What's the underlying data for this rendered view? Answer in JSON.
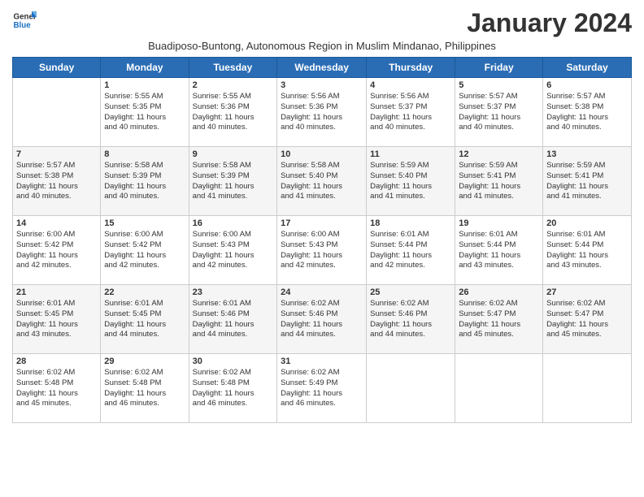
{
  "logo": {
    "general": "General",
    "blue": "Blue"
  },
  "title": "January 2024",
  "subtitle": "Buadiposo-Buntong, Autonomous Region in Muslim Mindanao, Philippines",
  "days_of_week": [
    "Sunday",
    "Monday",
    "Tuesday",
    "Wednesday",
    "Thursday",
    "Friday",
    "Saturday"
  ],
  "weeks": [
    [
      {
        "day": "",
        "info": ""
      },
      {
        "day": "1",
        "info": "Sunrise: 5:55 AM\nSunset: 5:35 PM\nDaylight: 11 hours\nand 40 minutes."
      },
      {
        "day": "2",
        "info": "Sunrise: 5:55 AM\nSunset: 5:36 PM\nDaylight: 11 hours\nand 40 minutes."
      },
      {
        "day": "3",
        "info": "Sunrise: 5:56 AM\nSunset: 5:36 PM\nDaylight: 11 hours\nand 40 minutes."
      },
      {
        "day": "4",
        "info": "Sunrise: 5:56 AM\nSunset: 5:37 PM\nDaylight: 11 hours\nand 40 minutes."
      },
      {
        "day": "5",
        "info": "Sunrise: 5:57 AM\nSunset: 5:37 PM\nDaylight: 11 hours\nand 40 minutes."
      },
      {
        "day": "6",
        "info": "Sunrise: 5:57 AM\nSunset: 5:38 PM\nDaylight: 11 hours\nand 40 minutes."
      }
    ],
    [
      {
        "day": "7",
        "info": "Sunrise: 5:57 AM\nSunset: 5:38 PM\nDaylight: 11 hours\nand 40 minutes."
      },
      {
        "day": "8",
        "info": "Sunrise: 5:58 AM\nSunset: 5:39 PM\nDaylight: 11 hours\nand 40 minutes."
      },
      {
        "day": "9",
        "info": "Sunrise: 5:58 AM\nSunset: 5:39 PM\nDaylight: 11 hours\nand 41 minutes."
      },
      {
        "day": "10",
        "info": "Sunrise: 5:58 AM\nSunset: 5:40 PM\nDaylight: 11 hours\nand 41 minutes."
      },
      {
        "day": "11",
        "info": "Sunrise: 5:59 AM\nSunset: 5:40 PM\nDaylight: 11 hours\nand 41 minutes."
      },
      {
        "day": "12",
        "info": "Sunrise: 5:59 AM\nSunset: 5:41 PM\nDaylight: 11 hours\nand 41 minutes."
      },
      {
        "day": "13",
        "info": "Sunrise: 5:59 AM\nSunset: 5:41 PM\nDaylight: 11 hours\nand 41 minutes."
      }
    ],
    [
      {
        "day": "14",
        "info": "Sunrise: 6:00 AM\nSunset: 5:42 PM\nDaylight: 11 hours\nand 42 minutes."
      },
      {
        "day": "15",
        "info": "Sunrise: 6:00 AM\nSunset: 5:42 PM\nDaylight: 11 hours\nand 42 minutes."
      },
      {
        "day": "16",
        "info": "Sunrise: 6:00 AM\nSunset: 5:43 PM\nDaylight: 11 hours\nand 42 minutes."
      },
      {
        "day": "17",
        "info": "Sunrise: 6:00 AM\nSunset: 5:43 PM\nDaylight: 11 hours\nand 42 minutes."
      },
      {
        "day": "18",
        "info": "Sunrise: 6:01 AM\nSunset: 5:44 PM\nDaylight: 11 hours\nand 42 minutes."
      },
      {
        "day": "19",
        "info": "Sunrise: 6:01 AM\nSunset: 5:44 PM\nDaylight: 11 hours\nand 43 minutes."
      },
      {
        "day": "20",
        "info": "Sunrise: 6:01 AM\nSunset: 5:44 PM\nDaylight: 11 hours\nand 43 minutes."
      }
    ],
    [
      {
        "day": "21",
        "info": "Sunrise: 6:01 AM\nSunset: 5:45 PM\nDaylight: 11 hours\nand 43 minutes."
      },
      {
        "day": "22",
        "info": "Sunrise: 6:01 AM\nSunset: 5:45 PM\nDaylight: 11 hours\nand 44 minutes."
      },
      {
        "day": "23",
        "info": "Sunrise: 6:01 AM\nSunset: 5:46 PM\nDaylight: 11 hours\nand 44 minutes."
      },
      {
        "day": "24",
        "info": "Sunrise: 6:02 AM\nSunset: 5:46 PM\nDaylight: 11 hours\nand 44 minutes."
      },
      {
        "day": "25",
        "info": "Sunrise: 6:02 AM\nSunset: 5:46 PM\nDaylight: 11 hours\nand 44 minutes."
      },
      {
        "day": "26",
        "info": "Sunrise: 6:02 AM\nSunset: 5:47 PM\nDaylight: 11 hours\nand 45 minutes."
      },
      {
        "day": "27",
        "info": "Sunrise: 6:02 AM\nSunset: 5:47 PM\nDaylight: 11 hours\nand 45 minutes."
      }
    ],
    [
      {
        "day": "28",
        "info": "Sunrise: 6:02 AM\nSunset: 5:48 PM\nDaylight: 11 hours\nand 45 minutes."
      },
      {
        "day": "29",
        "info": "Sunrise: 6:02 AM\nSunset: 5:48 PM\nDaylight: 11 hours\nand 46 minutes."
      },
      {
        "day": "30",
        "info": "Sunrise: 6:02 AM\nSunset: 5:48 PM\nDaylight: 11 hours\nand 46 minutes."
      },
      {
        "day": "31",
        "info": "Sunrise: 6:02 AM\nSunset: 5:49 PM\nDaylight: 11 hours\nand 46 minutes."
      },
      {
        "day": "",
        "info": ""
      },
      {
        "day": "",
        "info": ""
      },
      {
        "day": "",
        "info": ""
      }
    ]
  ]
}
